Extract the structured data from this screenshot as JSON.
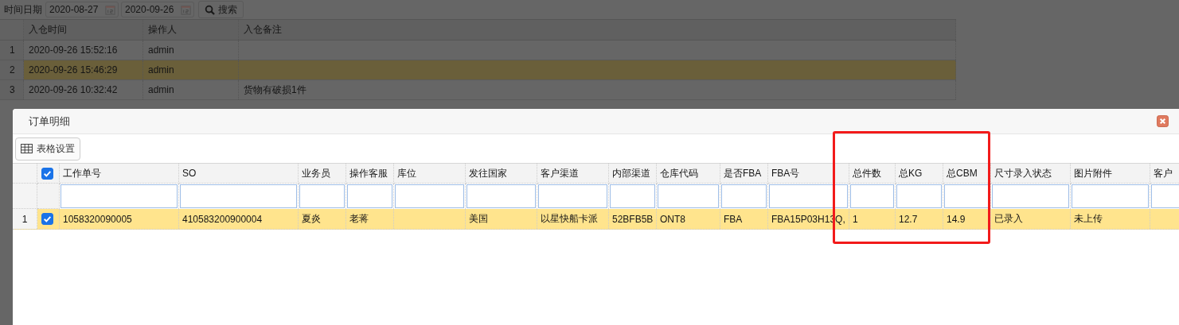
{
  "filter": {
    "label": "时间日期",
    "date_from": "2020-08-27",
    "date_to": "2020-09-26",
    "search_button": "搜索"
  },
  "inbound_table": {
    "columns": [
      "入仓时间",
      "操作人",
      "入仓备注"
    ],
    "rows": [
      {
        "index": "1",
        "time": "2020-09-26 15:52:16",
        "operator": "admin",
        "note": null,
        "selected": false
      },
      {
        "index": "2",
        "time": "2020-09-26 15:46:29",
        "operator": "admin",
        "note": null,
        "selected": true
      },
      {
        "index": "3",
        "time": "2020-09-26 10:32:42",
        "operator": "admin",
        "note": "货物有破损1件",
        "selected": false
      }
    ]
  },
  "dialog": {
    "title": "订单明细",
    "toolbar_button": "表格设置",
    "grid": {
      "select_all_checked": true,
      "columns": [
        "工作单号",
        "SO",
        "业务员",
        "操作客服",
        "库位",
        "发往国家",
        "客户渠道",
        "内部渠道",
        "仓库代码",
        "是否FBA",
        "FBA号",
        "总件数",
        "总KG",
        "总CBM",
        "尺寸录入状态",
        "图片附件",
        "客户"
      ],
      "rows": [
        {
          "index": "1",
          "checked": true,
          "selected": true,
          "cells": [
            "1058320090005",
            "410583200900004",
            "夏炎",
            "老蒋",
            null,
            "美国",
            "以星快船卡派",
            "52BFB5B",
            "ONT8",
            "FBA",
            "FBA15P03H13Q,",
            "1",
            "12.7",
            "14.9",
            "已录入",
            "未上传",
            null
          ]
        }
      ]
    }
  },
  "highlight": {
    "kind": "rectangle"
  }
}
